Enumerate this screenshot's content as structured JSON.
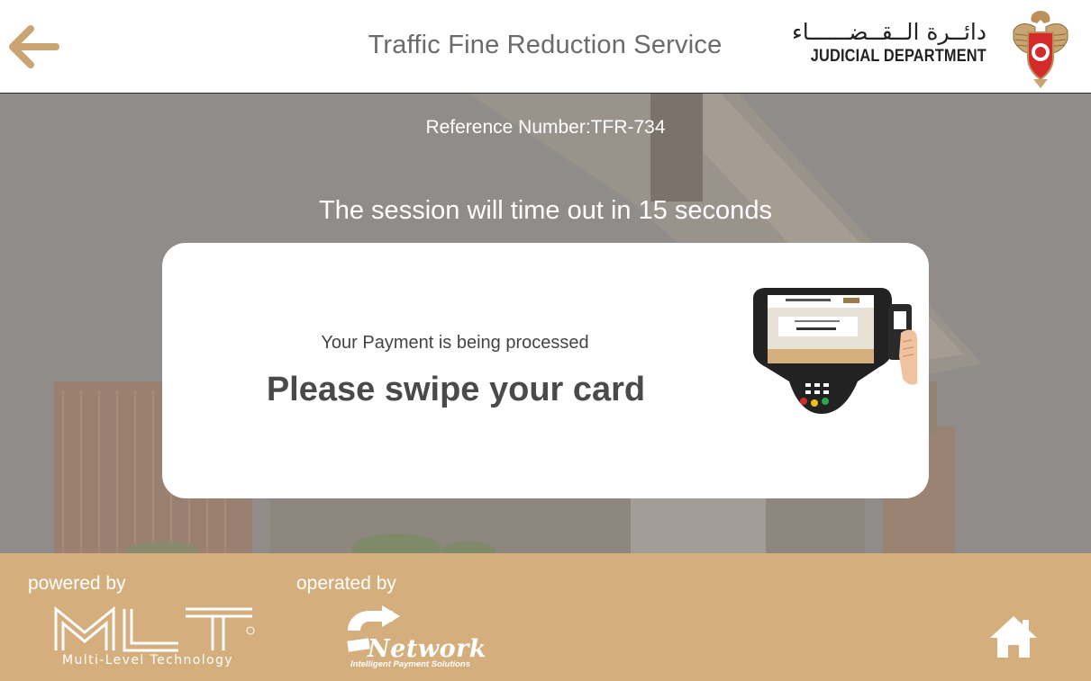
{
  "header": {
    "title": "Traffic Fine Reduction Service",
    "department_ar": "دائــرة الــقــضــــــاء",
    "department_en": "JUDICIAL DEPARTMENT",
    "back_icon": "arrow-left-icon",
    "emblem_icon": "falcon-emblem-icon"
  },
  "main": {
    "reference_number": "Reference Number:TFR-734",
    "timeout_message": "The session will time out in 15 seconds",
    "card": {
      "status_text": "Your Payment is being processed",
      "instruction": "Please swipe your card",
      "illustration": "card-terminal-icon"
    }
  },
  "footer": {
    "powered_by_label": "powered by",
    "operated_by_label": "operated by",
    "mlt_logo_text": "MLT",
    "mlt_tagline": "Multi-Level Technology",
    "network_logo_text": "Network",
    "network_tagline": "Intelligent Payment Solutions",
    "home_icon": "home-icon"
  },
  "colors": {
    "accent_gold": "#d4ae7c",
    "back_arrow": "#c9a574",
    "overlay_gray": "#8f8c89",
    "title_gray": "#6b6b6b"
  }
}
